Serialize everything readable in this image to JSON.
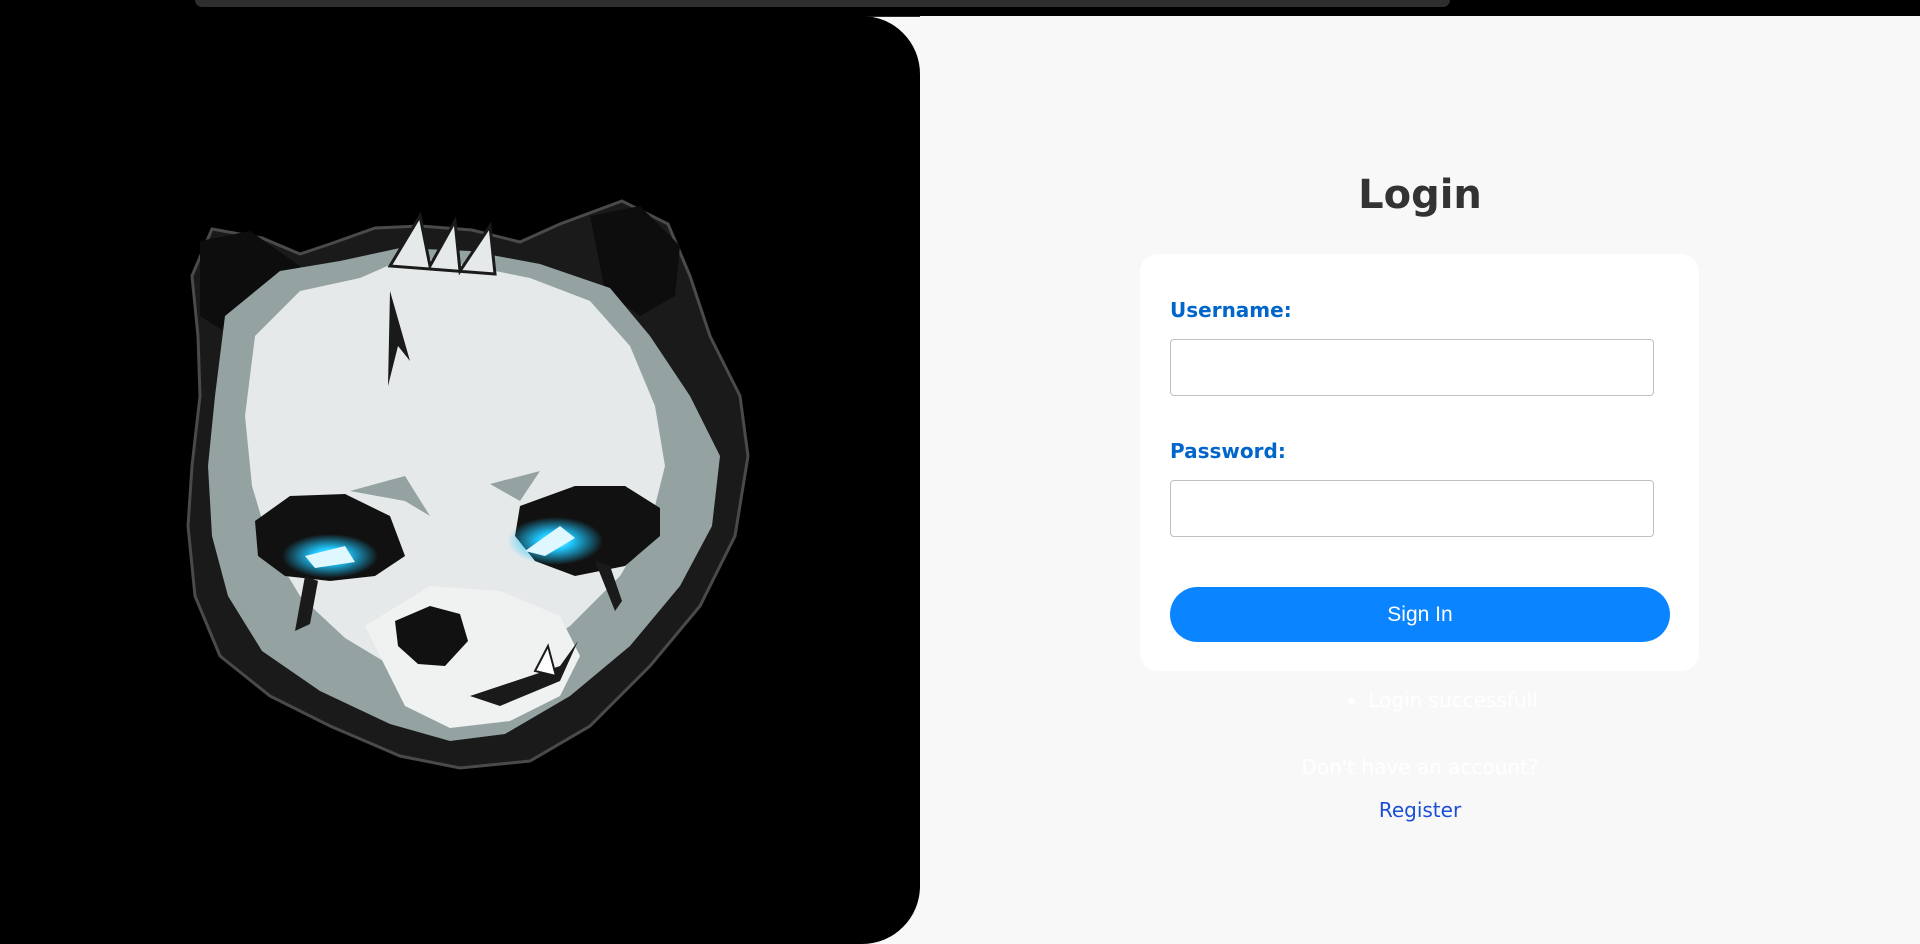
{
  "colors": {
    "hero_background": "#000000",
    "page_background": "#f8f8f8",
    "card_background": "#ffffff",
    "label_color": "#0066cc",
    "button_color": "#0a84ff",
    "link_color": "#1a4fd6",
    "eye_glow": "#1ec8ff"
  },
  "hero": {
    "image_icon": "panda-mascot-logo"
  },
  "login": {
    "title": "Login",
    "username_label": "Username:",
    "username_value": "",
    "username_placeholder": "",
    "password_label": "Password:",
    "password_value": "",
    "password_placeholder": "",
    "signin_label": "Sign In"
  },
  "messages": [
    "Login successfull"
  ],
  "footer": {
    "no_account_text": "Don't have an account?",
    "register_label": "Register"
  }
}
